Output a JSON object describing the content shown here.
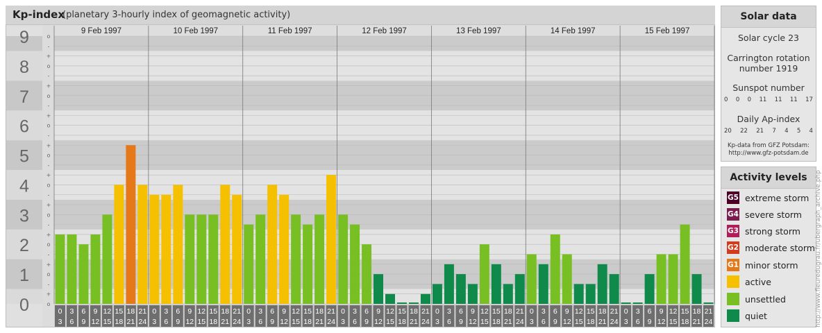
{
  "header": {
    "title": "Kp-index",
    "subtitle": "(planetary 3-hourly index of geomagnetic activity)"
  },
  "chart_data": {
    "type": "bar",
    "y_range": [
      0,
      9
    ],
    "y_ticks": [
      "0",
      "1",
      "2",
      "3",
      "4",
      "5",
      "6",
      "7",
      "8",
      "9"
    ],
    "sub_ticks": [
      "o",
      "+",
      "-"
    ],
    "days": [
      "9 Feb 1997",
      "10 Feb 1997",
      "11 Feb 1997",
      "12 Feb 1997",
      "13 Feb 1997",
      "14 Feb 1997",
      "15 Feb 1997"
    ],
    "hour_top": [
      "0",
      "3",
      "6",
      "9",
      "12",
      "15",
      "18",
      "21"
    ],
    "hour_bottom": [
      "3",
      "6",
      "9",
      "12",
      "15",
      "18",
      "21",
      "24"
    ],
    "values": [
      2.333,
      2.333,
      2.0,
      2.333,
      3.0,
      4.0,
      5.333,
      4.0,
      3.667,
      3.667,
      4.0,
      3.0,
      3.0,
      3.0,
      4.0,
      3.667,
      2.667,
      3.0,
      4.0,
      3.667,
      3.0,
      2.667,
      3.0,
      4.333,
      3.0,
      2.667,
      2.0,
      1.0,
      0.333,
      0.0,
      0.0,
      0.333,
      0.667,
      1.333,
      1.0,
      0.667,
      2.0,
      1.333,
      0.667,
      1.0,
      1.667,
      1.333,
      2.333,
      1.667,
      0.667,
      0.667,
      1.333,
      1.0,
      0.0,
      0.0,
      1.0,
      1.667,
      1.667,
      2.667,
      1.0,
      0.0
    ]
  },
  "solar": {
    "title": "Solar data",
    "cycle": "Solar cycle 23",
    "carrington_1": "Carrington rotation",
    "carrington_2": "number 1919",
    "sunspot_label": "Sunspot number",
    "sunspot_values": [
      "0",
      "0",
      "0",
      "11",
      "11",
      "11",
      "17"
    ],
    "ap_label": "Daily Ap-index",
    "ap_values": [
      "20",
      "22",
      "21",
      "7",
      "4",
      "5",
      "4"
    ],
    "source_1": "Kp-data from GFZ Potsdam:",
    "source_2": "http://www.gfz-potsdam.de"
  },
  "activity": {
    "title": "Activity levels",
    "levels": [
      {
        "badge": "G5",
        "label": "extreme storm",
        "color": "#4d0026"
      },
      {
        "badge": "G4",
        "label": "severe storm",
        "color": "#7a1d4e"
      },
      {
        "badge": "G3",
        "label": "strong storm",
        "color": "#b01e5a"
      },
      {
        "badge": "G2",
        "label": "moderate storm",
        "color": "#d23c1e"
      },
      {
        "badge": "G1",
        "label": "minor storm",
        "color": "#e5791a"
      },
      {
        "badge": "",
        "label": "active",
        "color": "#f5c000"
      },
      {
        "badge": "",
        "label": "unsettled",
        "color": "#78bf24"
      },
      {
        "badge": "",
        "label": "quiet",
        "color": "#0f8a4a"
      }
    ]
  },
  "footer_vertical": "http://www.fleuredugrau.fr/ubergraph_archive.php"
}
